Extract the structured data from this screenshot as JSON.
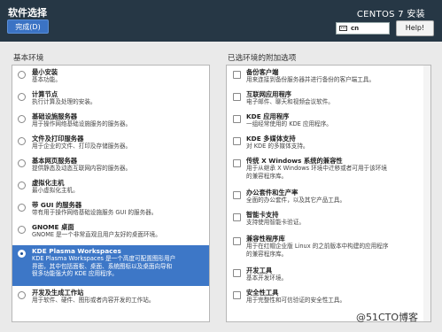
{
  "header": {
    "title": "软件选择",
    "done_button": "完成(D)",
    "os_title": "CENTOS 7 安装",
    "keyboard_layout": "cn",
    "help_button": "Help!"
  },
  "base_env": {
    "heading": "基本环境",
    "items": [
      {
        "title": "最小安装",
        "desc": "基本功能。"
      },
      {
        "title": "计算节点",
        "desc": "执行计算及处理的安装。"
      },
      {
        "title": "基础设施服务器",
        "desc": "用于操作网络基础设施服务的服务器。"
      },
      {
        "title": "文件及打印服务器",
        "desc": "用于企业的文件、打印及存储服务器。"
      },
      {
        "title": "基本网页服务器",
        "desc": "提供静态及动态互联网内容的服务器。"
      },
      {
        "title": "虚拟化主机",
        "desc": "最小虚拟化主机。"
      },
      {
        "title": "带 GUI 的服务器",
        "desc": "带有用于操作网络基础设施服务 GUI 的服务器。"
      },
      {
        "title": "GNOME 桌面",
        "desc": "GNOME 是一个非常直观且用户友好的桌面环境。"
      },
      {
        "title": "KDE Plasma Workspaces",
        "desc": [
          "KDE Plasma Workspaces 是一个高度可配置图形用户",
          "界面，其中包括面板、桌面、系统图标以及桌面向导和",
          "很多功能强大的 KDE 应用程序。"
        ],
        "selected": true
      },
      {
        "title": "开发及生成工作站",
        "desc": "用于软件、硬件、图形或者内容开发的工作站。"
      }
    ]
  },
  "addons": {
    "heading": "已选环境的附加选项",
    "items": [
      {
        "title": "备份客户端",
        "desc": "用来连接到备份服务器并进行备份的客户端工具。"
      },
      {
        "title": "互联网应用程序",
        "desc": "电子邮件、聊天和视频会议软件。"
      },
      {
        "title": "KDE 应用程序",
        "desc": "一组经常使用的 KDE 应用程序。"
      },
      {
        "title": "KDE 多媒体支持",
        "desc": "对 KDE 的多媒体支持。"
      },
      {
        "title": "传统 X Windows 系统的兼容性",
        "desc": [
          "用于从继承 X Windows 环境中迁移或者可用于该环境",
          "的兼容程序库。"
        ]
      },
      {
        "title": "办公套件和生产率",
        "desc": "全面的办公套件，以及其它产品工具。"
      },
      {
        "title": "智能卡支持",
        "desc": "支持使用智能卡验证。"
      },
      {
        "title": "兼容性程序库",
        "desc": [
          "用于在红帽企业版 Linux 的之前版本中构建的应用程序",
          "的兼容程序库。"
        ]
      },
      {
        "title": "开发工具",
        "desc": "基本开发环境。"
      },
      {
        "title": "安全性工具",
        "desc": "用于完整性和可信验证的安全性工具。"
      }
    ]
  },
  "watermark": "@51CTO博客",
  "colors": {
    "header_bg": "#263745",
    "selected_bg": "#3d77c7",
    "done_button": "#3b73c4"
  }
}
